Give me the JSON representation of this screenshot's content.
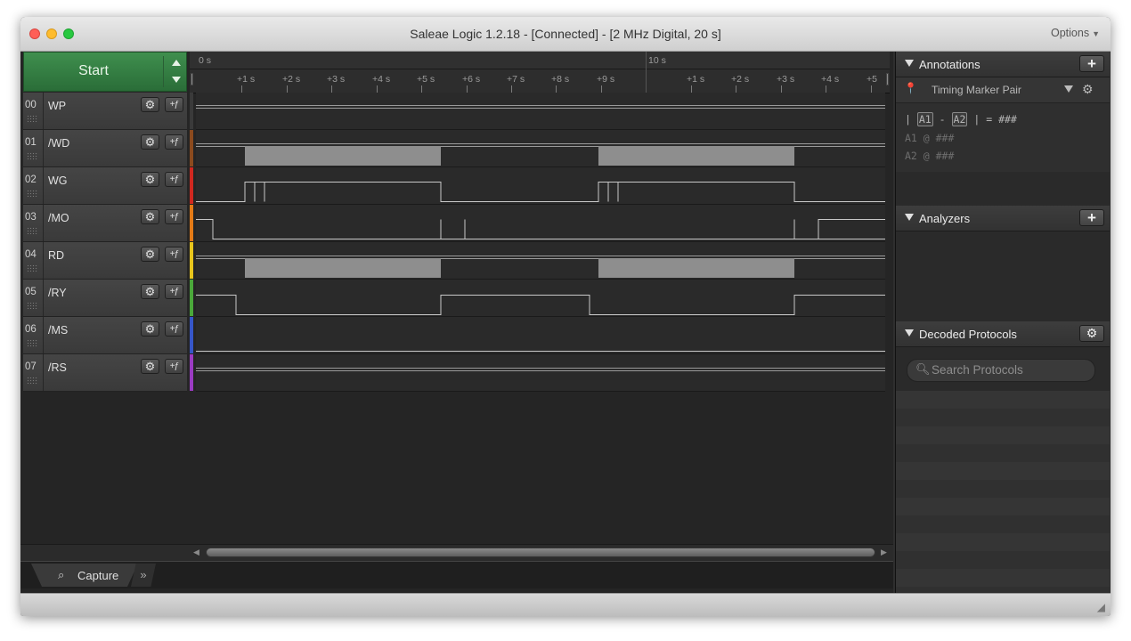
{
  "window": {
    "title": "Saleae Logic 1.2.18 - [Connected] - [2 MHz Digital, 20 s]",
    "options_label": "Options",
    "traffic_lights": {
      "close": "#ff5f57",
      "minimize": "#febc2e",
      "zoom": "#28c840"
    }
  },
  "capture": {
    "start_label": "Start"
  },
  "ruler": {
    "major_labels": [
      "0 s",
      "10 s"
    ],
    "minor_labels_left": [
      "+1 s",
      "+2 s",
      "+3 s",
      "+4 s",
      "+5 s",
      "+6 s",
      "+7 s",
      "+8 s",
      "+9 s"
    ],
    "minor_labels_right": [
      "+1 s",
      "+2 s",
      "+3 s",
      "+4 s",
      "+5"
    ]
  },
  "channels": [
    {
      "num": "00",
      "name": "WP",
      "color": "#3a3a3a"
    },
    {
      "num": "01",
      "name": "/WD",
      "color": "#8b4a1e"
    },
    {
      "num": "02",
      "name": "WG",
      "color": "#d0281f"
    },
    {
      "num": "03",
      "name": "/MO",
      "color": "#e37a16"
    },
    {
      "num": "04",
      "name": "RD",
      "color": "#e8c51c"
    },
    {
      "num": "05",
      "name": "/RY",
      "color": "#4aa83a"
    },
    {
      "num": "06",
      "name": "/MS",
      "color": "#3656c8"
    },
    {
      "num": "07",
      "name": "/RS",
      "color": "#9b3bc2"
    }
  ],
  "tabs": {
    "capture_label": "Capture",
    "more_label": "»"
  },
  "annotations": {
    "title": "Annotations",
    "marker_label": "Timing Marker Pair",
    "line1": {
      "pipe1": "|",
      "a1": "A1",
      "dash": "-",
      "a2": "A2",
      "pipe2": "|",
      "eq": "= ###"
    },
    "line2": "A1  @  ###",
    "line3": "A2  @  ###"
  },
  "analyzers": {
    "title": "Analyzers"
  },
  "decoded_protocols": {
    "title": "Decoded Protocols",
    "search_placeholder": "Search Protocols"
  }
}
